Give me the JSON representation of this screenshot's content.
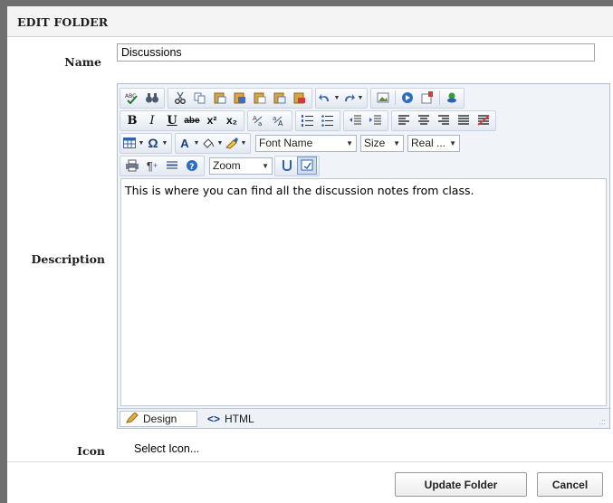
{
  "header": {
    "title": "EDIT FOLDER"
  },
  "form": {
    "name_label": "Name",
    "name_value": "Discussions",
    "description_label": "Description",
    "icon_label": "Icon",
    "select_icon": "Select Icon..."
  },
  "editor": {
    "content": "This is where you can find all the discussion notes from class.",
    "font_name": "Font Name",
    "size": "Size",
    "real": "Real ...",
    "zoom": "Zoom",
    "mode_design": "Design",
    "mode_html": "HTML",
    "toolbar_icons": {
      "row1": [
        "spell-check-icon",
        "find-replace-icon",
        "cut-icon",
        "copy-icon",
        "paste-icon",
        "paste-from-word-icon",
        "paste-plain-text-icon",
        "paste-as-html-icon",
        "paste-html-icon",
        "undo-icon",
        "redo-icon",
        "image-manager-icon",
        "media-icon",
        "flash-icon",
        "hyperlink-manager-icon"
      ],
      "row2": [
        "bold-icon",
        "italic-icon",
        "underline-icon",
        "strikethrough-icon",
        "superscript-icon",
        "subscript-icon",
        "convert-lower-icon",
        "convert-upper-icon",
        "numbered-list-icon",
        "bullet-list-icon",
        "outdent-icon",
        "indent-icon",
        "align-left-icon",
        "align-center-icon",
        "align-right-icon",
        "justify-icon",
        "remove-alignment-icon"
      ],
      "row3": [
        "table-icon",
        "special-chars-icon",
        "foreground-color-icon",
        "background-color-icon",
        "format-stripper-icon"
      ],
      "row4": [
        "print-icon",
        "paragraph-icon",
        "line-icon",
        "help-icon",
        "module-manager-icon",
        "track-changes-icon"
      ]
    }
  },
  "buttons": {
    "update": "Update Folder",
    "cancel": "Cancel"
  },
  "colors": {
    "accent": "#2b4a7a",
    "chrome": "#6f6f6f",
    "editor_bg": "#f0f3f7"
  }
}
